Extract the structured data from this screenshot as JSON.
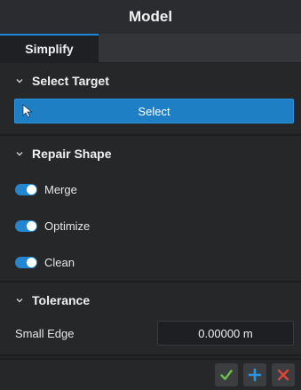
{
  "window": {
    "title": "Model"
  },
  "tabs": [
    {
      "label": "Simplify",
      "active": true
    }
  ],
  "sections": {
    "select_target": {
      "title": "Select Target",
      "button_label": "Select"
    },
    "repair_shape": {
      "title": "Repair Shape",
      "toggles": [
        {
          "label": "Merge",
          "on": true
        },
        {
          "label": "Optimize",
          "on": true
        },
        {
          "label": "Clean",
          "on": true
        }
      ]
    },
    "tolerance": {
      "title": "Tolerance",
      "small_edge_label": "Small Edge",
      "small_edge_value": "0.00000 m"
    }
  },
  "footer": {
    "icons": [
      "check-icon",
      "plus-icon",
      "close-icon"
    ]
  },
  "colors": {
    "accent": "#1f7fc4",
    "ok": "#6cc04a",
    "add": "#2a95e0",
    "cancel": "#e0443a"
  }
}
